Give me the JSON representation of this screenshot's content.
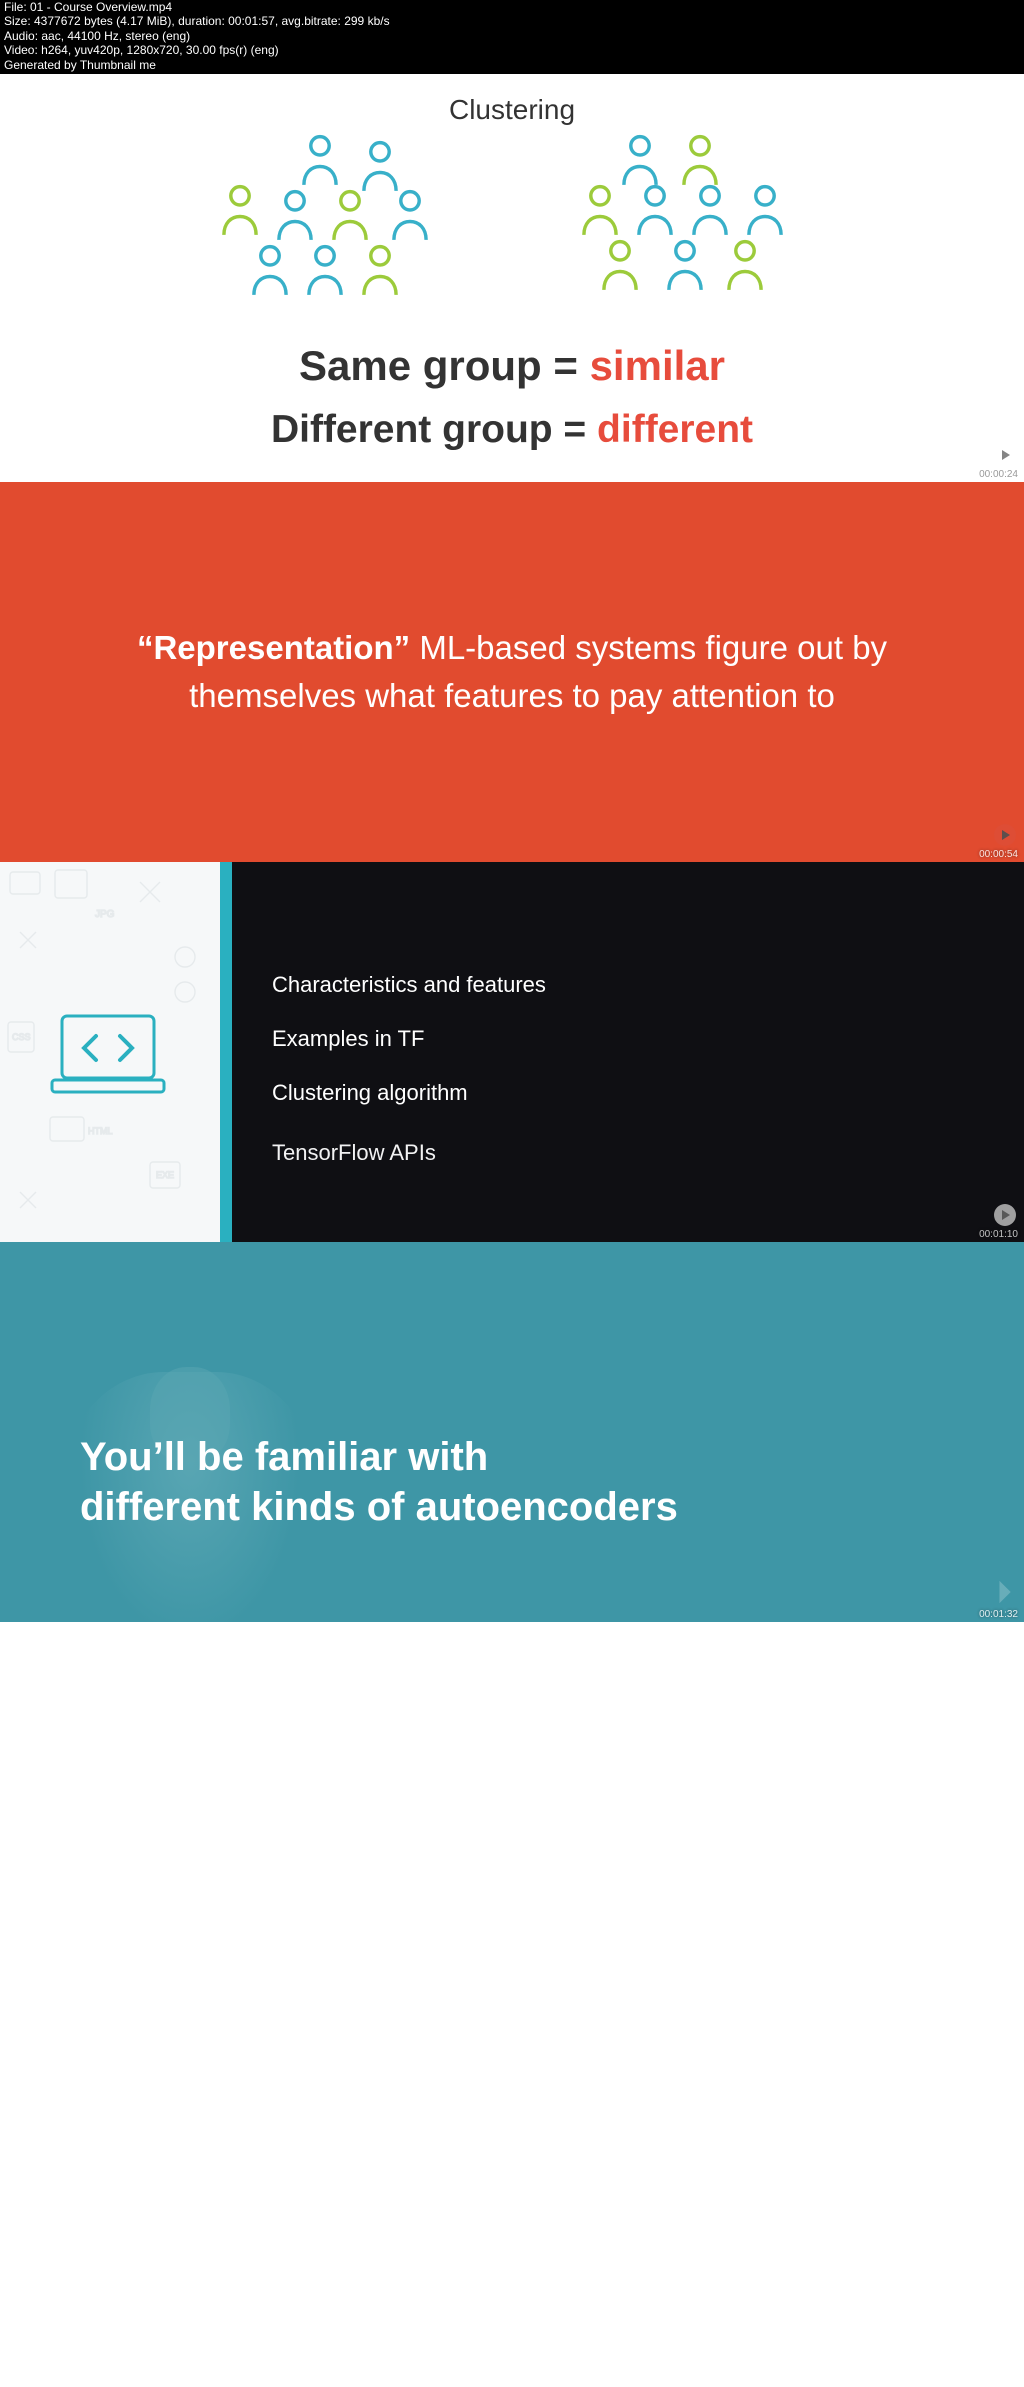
{
  "header": {
    "file": "File: 01 - Course Overview.mp4",
    "size": "Size: 4377672 bytes (4.17 MiB), duration: 00:01:57, avg.bitrate: 299 kb/s",
    "audio": "Audio: aac, 44100 Hz, stereo (eng)",
    "video": "Video: h264, yuv420p, 1280x720, 30.00 fps(r) (eng)",
    "gen": "Generated by Thumbnail me"
  },
  "frame1": {
    "title": "Clustering",
    "line1_a": "Same group = ",
    "line1_b": "similar",
    "line2_a": "Different group = ",
    "line2_b": "different",
    "timestamp": "00:00:24"
  },
  "frame2": {
    "bold": "“Representation”",
    "rest": " ML-based systems figure out by themselves what features to pay attention to",
    "timestamp": "00:00:54"
  },
  "frame3": {
    "items": {
      "a": "Characteristics and features",
      "b": "Examples in TF",
      "c": "Clustering algorithm",
      "d": "TensorFlow APIs"
    },
    "timestamp": "00:01:10"
  },
  "frame4": {
    "line1": "You’ll be familiar with",
    "line2": "different kinds of autoencoders",
    "timestamp": "00:01:32"
  },
  "colors": {
    "orange": "#e14b2f",
    "teal_accent": "#2ab0c0",
    "teal_bg": "#3e96a6",
    "red_accent": "#e74c3c",
    "person_blue": "#38b0c9",
    "person_green": "#9ccb3b"
  }
}
